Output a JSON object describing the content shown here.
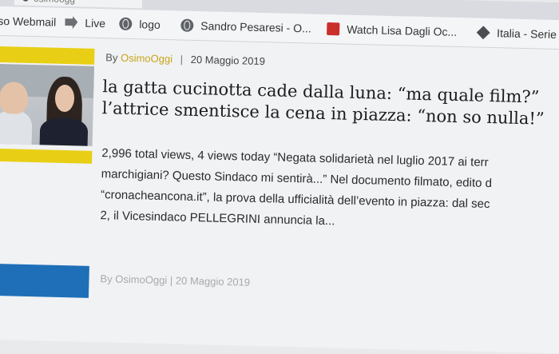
{
  "tabstrip": {
    "tab_fragment": "osimoogg"
  },
  "bookmarks": [
    {
      "label": "so Webmail",
      "icon": "none"
    },
    {
      "label": "Live",
      "icon": "page-icon"
    },
    {
      "label": "logo",
      "icon": "globe-icon"
    },
    {
      "label": "Sandro Pesaresi - O...",
      "icon": "globe-icon"
    },
    {
      "label": "Watch Lisa Dagli Oc...",
      "icon": "video-icon"
    },
    {
      "label": "Italia - Serie",
      "icon": "apps-icon"
    }
  ],
  "article": {
    "by_label": "By",
    "author": "OsimoOggi",
    "separator": "|",
    "date": "20 Maggio 2019",
    "headline_line1": "la gatta cucinotta cade dalla luna: “ma quale film?”",
    "headline_line2": "l’attrice smentisce la cena in piazza: “non so nulla!”",
    "excerpt_line1": "2,996 total views,  4 views today “Negata solidarietà nel luglio 2017 ai terr",
    "excerpt_line2": "marchigiani? Questo Sindaco mi sentirà...” Nel documento filmato,  edito d",
    "excerpt_line3": "“cronacheancona.it”, la prova della ufficialità dell’evento in piazza: dal sec",
    "excerpt_line4": "2, il Vicesindaco PELLEGRINI annuncia la..."
  },
  "next_article": {
    "meta": "By OsimoOggi | 20 Maggio 2019"
  },
  "colors": {
    "accent_yellow": "#e8cf16",
    "author_link": "#c8a417",
    "blue_bar": "#1e6fb8"
  }
}
